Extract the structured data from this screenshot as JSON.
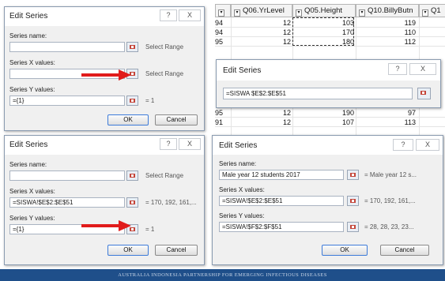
{
  "colors": {
    "arrow": "#e11b1b",
    "footer_bg": "#1f4f8a",
    "dialog_border": "#8a9bb0"
  },
  "dialog1": {
    "title": "Edit Series",
    "help": "?",
    "close": "X",
    "name_label": "Series name:",
    "name_hint": "Select Range",
    "x_label": "Series X values:",
    "x_hint": "Select Range",
    "y_label": "Series Y values:",
    "y_value": "={1}",
    "y_hint": "= 1",
    "ok": "OK",
    "cancel": "Cancel"
  },
  "dialog2": {
    "title": "Edit Series",
    "help": "?",
    "close": "X",
    "name_label": "Series name:",
    "name_hint": "Select Range",
    "x_label": "Series X values:",
    "x_value": "=SISWA!$E$2:$E$51",
    "x_hint": "= 170, 192, 161,...",
    "y_label": "Series Y values:",
    "y_value": "={1}",
    "y_hint": "= 1",
    "ok": "OK",
    "cancel": "Cancel"
  },
  "sheet": {
    "headers": [
      "Q06.YrLevel",
      "Q05.Height",
      "Q10.BillyButn",
      "Q1"
    ],
    "rows": [
      [
        "94",
        "12",
        "103",
        "119"
      ],
      [
        "94",
        "12",
        "170",
        "110"
      ],
      [
        "95",
        "12",
        "180",
        "112"
      ],
      [
        "95",
        "12",
        "190",
        "97"
      ],
      [
        "91",
        "12",
        "107",
        "113"
      ]
    ]
  },
  "dialog3": {
    "title": "Edit Series",
    "help": "?",
    "close": "X",
    "value": "=SISWA $E$2:$E$51"
  },
  "dialog4": {
    "title": "Edit Series",
    "help": "?",
    "close": "X",
    "name_label": "Series name:",
    "name_value": "Male year 12 students 2017",
    "name_hint": "= Male year 12 s...",
    "x_label": "Series X values:",
    "x_value": "=SISWA!$E$2:$E$51",
    "x_hint": "= 170, 192, 161,...",
    "y_label": "Series Y values:",
    "y_value": "=SISWA!$F$2:$F$51",
    "y_hint": "= 28, 28, 23, 23...",
    "ok": "OK",
    "cancel": "Cancel"
  },
  "footer": {
    "text": "AUSTRALIA INDONESIA PARTNERSHIP FOR EMERGING INFECTIOUS DISEASES"
  }
}
